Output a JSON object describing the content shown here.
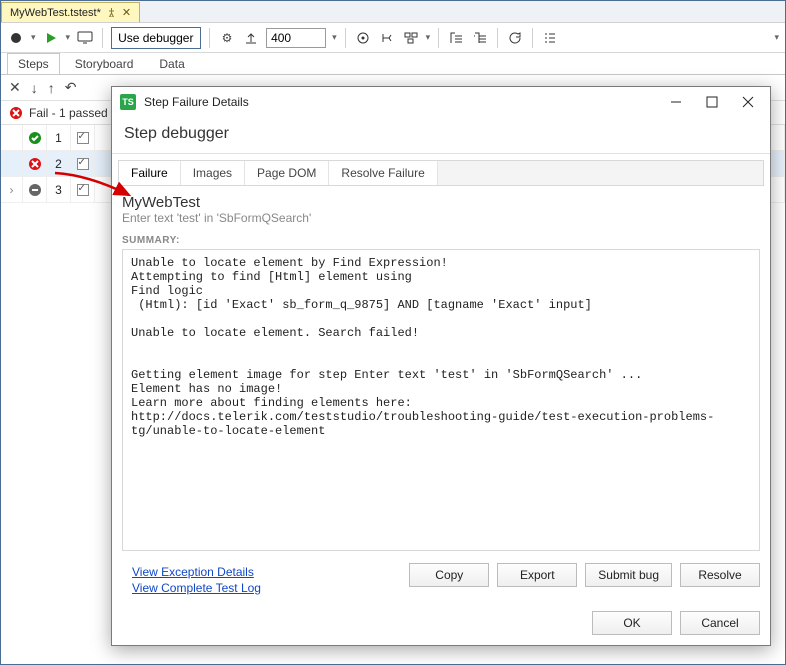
{
  "file_tab": {
    "name": "MyWebTest.tstest*"
  },
  "toolbar": {
    "debug_label": "Use debugger",
    "delay_value": "400"
  },
  "tabs": [
    "Steps",
    "Storyboard",
    "Data"
  ],
  "active_tab": 0,
  "status_text": "Fail - 1 passed",
  "steps": [
    {
      "num": "1",
      "status": "pass"
    },
    {
      "num": "2",
      "status": "fail"
    },
    {
      "num": "3",
      "status": "skip"
    }
  ],
  "dialog": {
    "title": "Step Failure Details",
    "subtitle": "Step debugger",
    "tabs": [
      "Failure",
      "Images",
      "Page DOM",
      "Resolve Failure"
    ],
    "active_tab": 0,
    "test_name": "MyWebTest",
    "step_desc": "Enter text 'test' in 'SbFormQSearch'",
    "summary_label": "SUMMARY:",
    "summary": "Unable to locate element by Find Expression!\nAttempting to find [Html] element using\nFind logic\n (Html): [id 'Exact' sb_form_q_9875] AND [tagname 'Exact' input]\n\nUnable to locate element. Search failed!\n\n\nGetting element image for step Enter text 'test' in 'SbFormQSearch' ...\nElement has no image!\nLearn more about finding elements here:\nhttp://docs.telerik.com/teststudio/troubleshooting-guide/test-execution-problems-tg/unable-to-locate-element",
    "link_exception": "View Exception Details",
    "link_log": "View Complete Test Log",
    "btn_copy": "Copy",
    "btn_export": "Export",
    "btn_submit": "Submit bug",
    "btn_resolve": "Resolve",
    "btn_ok": "OK",
    "btn_cancel": "Cancel"
  }
}
